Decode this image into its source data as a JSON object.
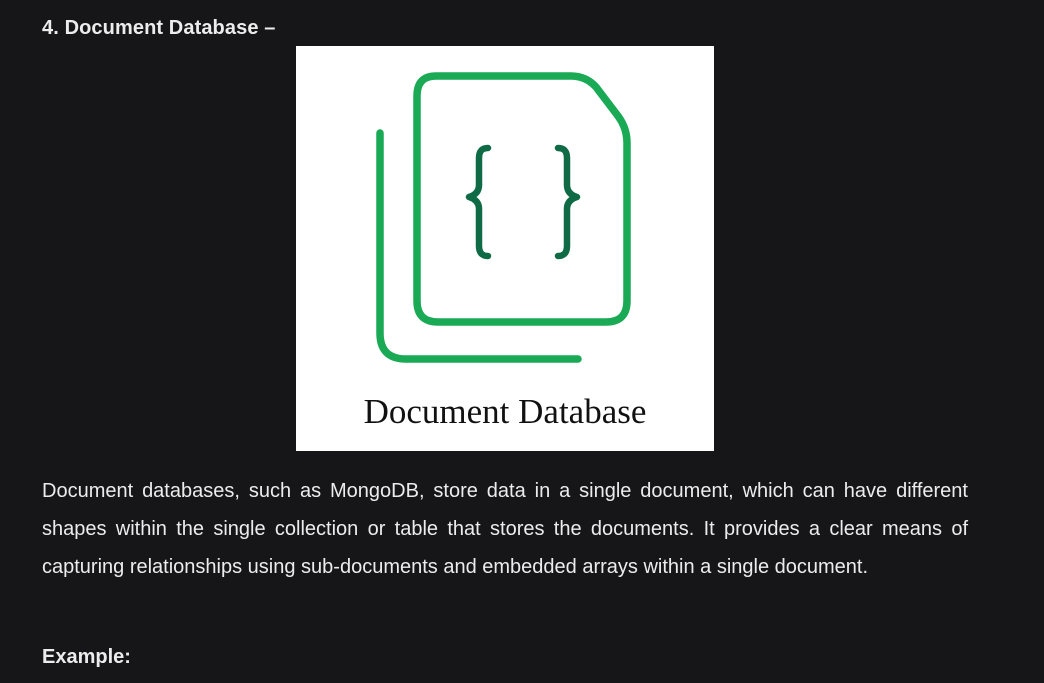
{
  "heading": {
    "number": "4.",
    "title": "Document Database",
    "suffix": "–"
  },
  "figure": {
    "icon": "document-database-icon",
    "caption": "Document Database",
    "colors": {
      "outline": "#1aa955",
      "braces": "#0f6b45",
      "background": "#ffffff"
    }
  },
  "body": {
    "paragraph": "Document databases, such as MongoDB, store data in a single document, which can have different shapes within the single collection or table that stores the documents. It provides a clear means of capturing relationships using sub-documents and embedded arrays within a single document."
  },
  "example": {
    "label": "Example:"
  },
  "colors": {
    "page_background": "#161618",
    "text": "#ececec"
  }
}
